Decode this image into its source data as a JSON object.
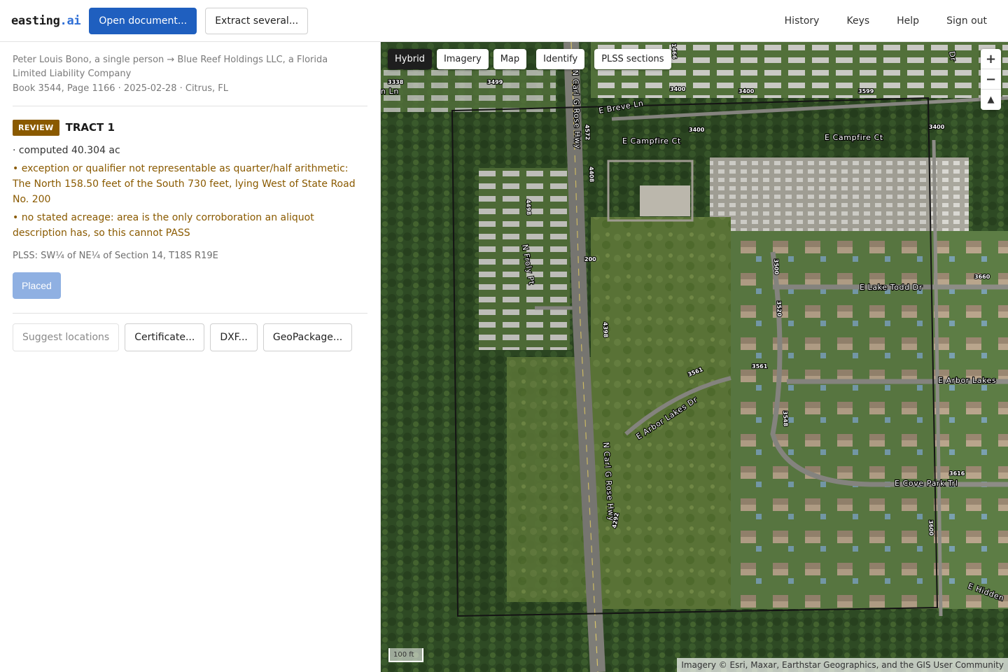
{
  "header": {
    "logo_main": "easting",
    "logo_dot": ".ai",
    "open_label": "Open document...",
    "extract_label": "Extract several...",
    "nav": {
      "history": "History",
      "keys": "Keys",
      "help": "Help",
      "signout": "Sign out"
    }
  },
  "deed": {
    "parties": "Peter Louis Bono, a single person → Blue Reef Holdings LLC, a Florida Limited Liability Company",
    "meta": "Book 3544, Page 1166 · 2025-02-28 · Citrus, FL"
  },
  "tract": {
    "status": "REVIEW",
    "status_color": "#8a5a00",
    "title": "TRACT 1",
    "computed": "· computed 40.304 ac",
    "warnings": [
      "• exception or qualifier not representable as quarter/half arithmetic: The North 158.50 feet of the South 730 feet, lying West of State Road No. 200",
      "• no stated acreage: area is the only corroboration an aliquot description has, so this cannot PASS"
    ],
    "plss": "PLSS: SW¼ of NE¼ of Section 14, T18S R19E",
    "placed_label": "Placed"
  },
  "actions": {
    "suggest": "Suggest locations",
    "certificate": "Certificate...",
    "dxf": "DXF...",
    "geopackage": "GeoPackage..."
  },
  "map": {
    "tabs": {
      "hybrid": "Hybrid",
      "imagery": "Imagery",
      "map": "Map",
      "identify": "Identify",
      "plss": "PLSS sections"
    },
    "active_tab": "Hybrid",
    "zoom_in": "+",
    "zoom_out": "−",
    "reset": "▲",
    "scale": "100 ft",
    "attribution": "Imagery © Esri, Maxar, Earthstar Geographics, and the GIS User Community",
    "roads": {
      "rose_north": "N Carl G Rose Hwy",
      "rose_south": "N Carl G Rose Hwy",
      "campfire_w": "E Campfire Ct",
      "campfire_e": "E Campfire Ct",
      "breve": "E Breve Ln",
      "froly": "N Froly Pt",
      "lake_todd": "E Lake Todd Dr",
      "arbor_lakes": "E Arbor Lakes",
      "arbor_lakes_dr": "E Arbor Lakes Dr",
      "cove_park": "E Cove Park Trl",
      "hidden": "E Hidden",
      "ln_left": "n Ln",
      "dr_top": "Dr"
    },
    "numbers": [
      "3338",
      "3499",
      "3400",
      "3400",
      "3599",
      "3400",
      "3400",
      "4572",
      "4408",
      "4498",
      "3500",
      "3520",
      "3660",
      "3561",
      "3561",
      "3548",
      "4398",
      "3616",
      "3600",
      "4292",
      "200",
      "1466"
    ]
  }
}
